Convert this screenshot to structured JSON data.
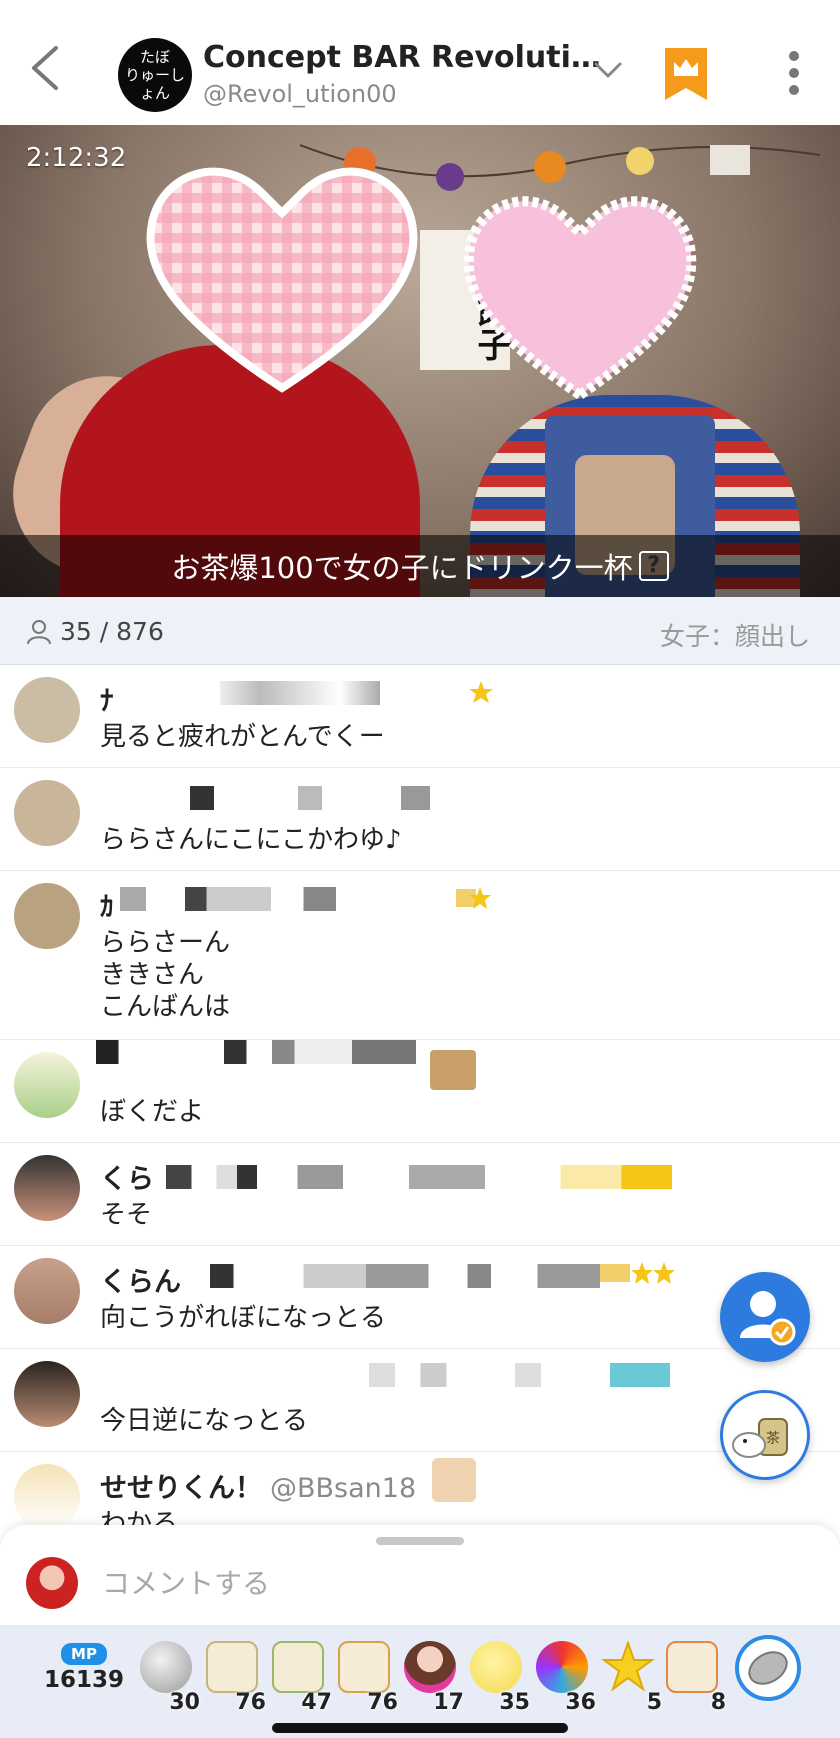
{
  "header": {
    "channel_avatar_text": "たぼ\nりゅーしょん",
    "title": "Concept BAR Revolution…",
    "handle": "@Revol_ution00"
  },
  "video": {
    "timestamp": "2:12:32",
    "sign_text": "水餃子",
    "caption": "お茶爆100で女の子にドリンク一杯",
    "caption_help": "?"
  },
  "stats": {
    "viewers": "35 / 876",
    "tag": "女子：顔出し"
  },
  "comments": [
    {
      "name": "ﾅ",
      "handle": "",
      "text": "見ると疲れがとんでくー"
    },
    {
      "name": "",
      "handle": "",
      "text": "ららさんにこにこかわゆ♪"
    },
    {
      "name": "ｶ",
      "handle": "",
      "text": "ららさーん\nききさん\nこんばんは"
    },
    {
      "name": "",
      "handle": "",
      "text": "ぼくだよ"
    },
    {
      "name": "くら",
      "handle": "",
      "text": "そそ"
    },
    {
      "name": "くらん",
      "handle": "",
      "text": "向こうがれぼになっとる"
    },
    {
      "name": "",
      "handle": "",
      "text": "今日逆になっとる"
    },
    {
      "name": "せせりくん！",
      "handle": "@BBsan18",
      "text": "わかる"
    }
  ],
  "composer": {
    "placeholder": "コメントする"
  },
  "gift_bar": {
    "mp_label": "MP",
    "mp_value": "16139",
    "gifts": [
      {
        "icon": "silver-coin-icon",
        "count": "30"
      },
      {
        "icon": "tea-cup-100-icon",
        "count": "76"
      },
      {
        "icon": "tea-cup-10-icon",
        "count": "47"
      },
      {
        "icon": "tea-cup-icon",
        "count": "76"
      },
      {
        "icon": "idol-girl-icon",
        "count": "17"
      },
      {
        "icon": "chick-icon",
        "count": "35"
      },
      {
        "icon": "fireworks-icon",
        "count": "36"
      },
      {
        "icon": "star-icon",
        "count": "5"
      },
      {
        "icon": "tea-cup-50-icon",
        "count": "8"
      }
    ]
  },
  "colors": {
    "accent": "#2e7be0",
    "crown": "#f59a1b",
    "stats_bg": "#eef1f7",
    "gift_bg": "#e7ecf7"
  }
}
